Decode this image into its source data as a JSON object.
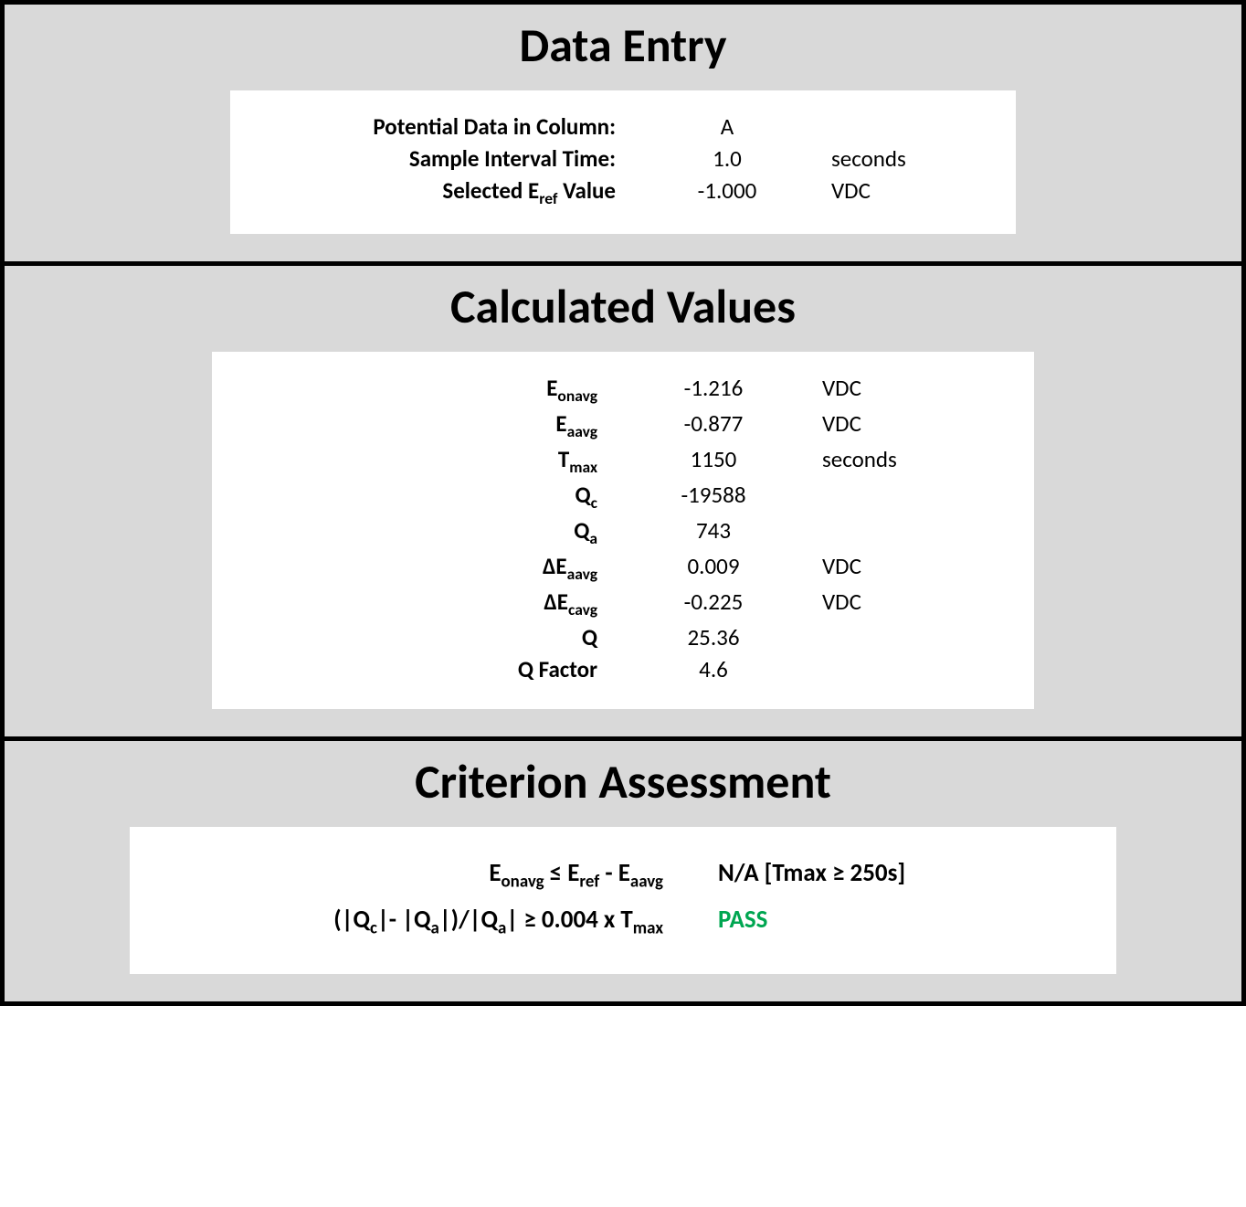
{
  "data_entry": {
    "title": "Data Entry",
    "rows": [
      {
        "label_html": "Potential Data in Column:",
        "value": "A",
        "unit": ""
      },
      {
        "label_html": "Sample Interval Time:",
        "value": "1.0",
        "unit": "seconds"
      },
      {
        "label_html": "Selected E<sub>ref</sub> Value",
        "value": "-1.000",
        "unit": "VDC"
      }
    ]
  },
  "calculated": {
    "title": "Calculated Values",
    "rows": [
      {
        "label_html": "E<sub>onavg</sub>",
        "value": "-1.216",
        "unit": "VDC"
      },
      {
        "label_html": "E<sub>aavg</sub>",
        "value": "-0.877",
        "unit": "VDC"
      },
      {
        "label_html": "T<sub>max</sub>",
        "value": "1150",
        "unit": "seconds"
      },
      {
        "label_html": "Q<sub>c</sub>",
        "value": "-19588",
        "unit": ""
      },
      {
        "label_html": "Q<sub>a</sub>",
        "value": "743",
        "unit": ""
      },
      {
        "label_html": "ΔE<sub>aavg</sub>",
        "value": "0.009",
        "unit": "VDC"
      },
      {
        "label_html": "ΔE<sub>cavg</sub>",
        "value": "-0.225",
        "unit": "VDC"
      },
      {
        "label_html": "Q",
        "value": "25.36",
        "unit": ""
      },
      {
        "label_html": "Q Factor",
        "value": "4.6",
        "unit": ""
      }
    ]
  },
  "criterion": {
    "title": "Criterion Assessment",
    "rows": [
      {
        "label_html": "E<sub>onavg</sub> ≤ E<sub>ref</sub> - E<sub>aavg</sub>",
        "result": "N/A [Tmax ≥ 250s]",
        "pass": false
      },
      {
        "label_html": "(|Q<sub>c</sub>|- |Q<sub>a</sub>|)/|Q<sub>a</sub>| ≥ 0.004 x T<sub>max</sub>",
        "result": "PASS",
        "pass": true
      }
    ]
  }
}
